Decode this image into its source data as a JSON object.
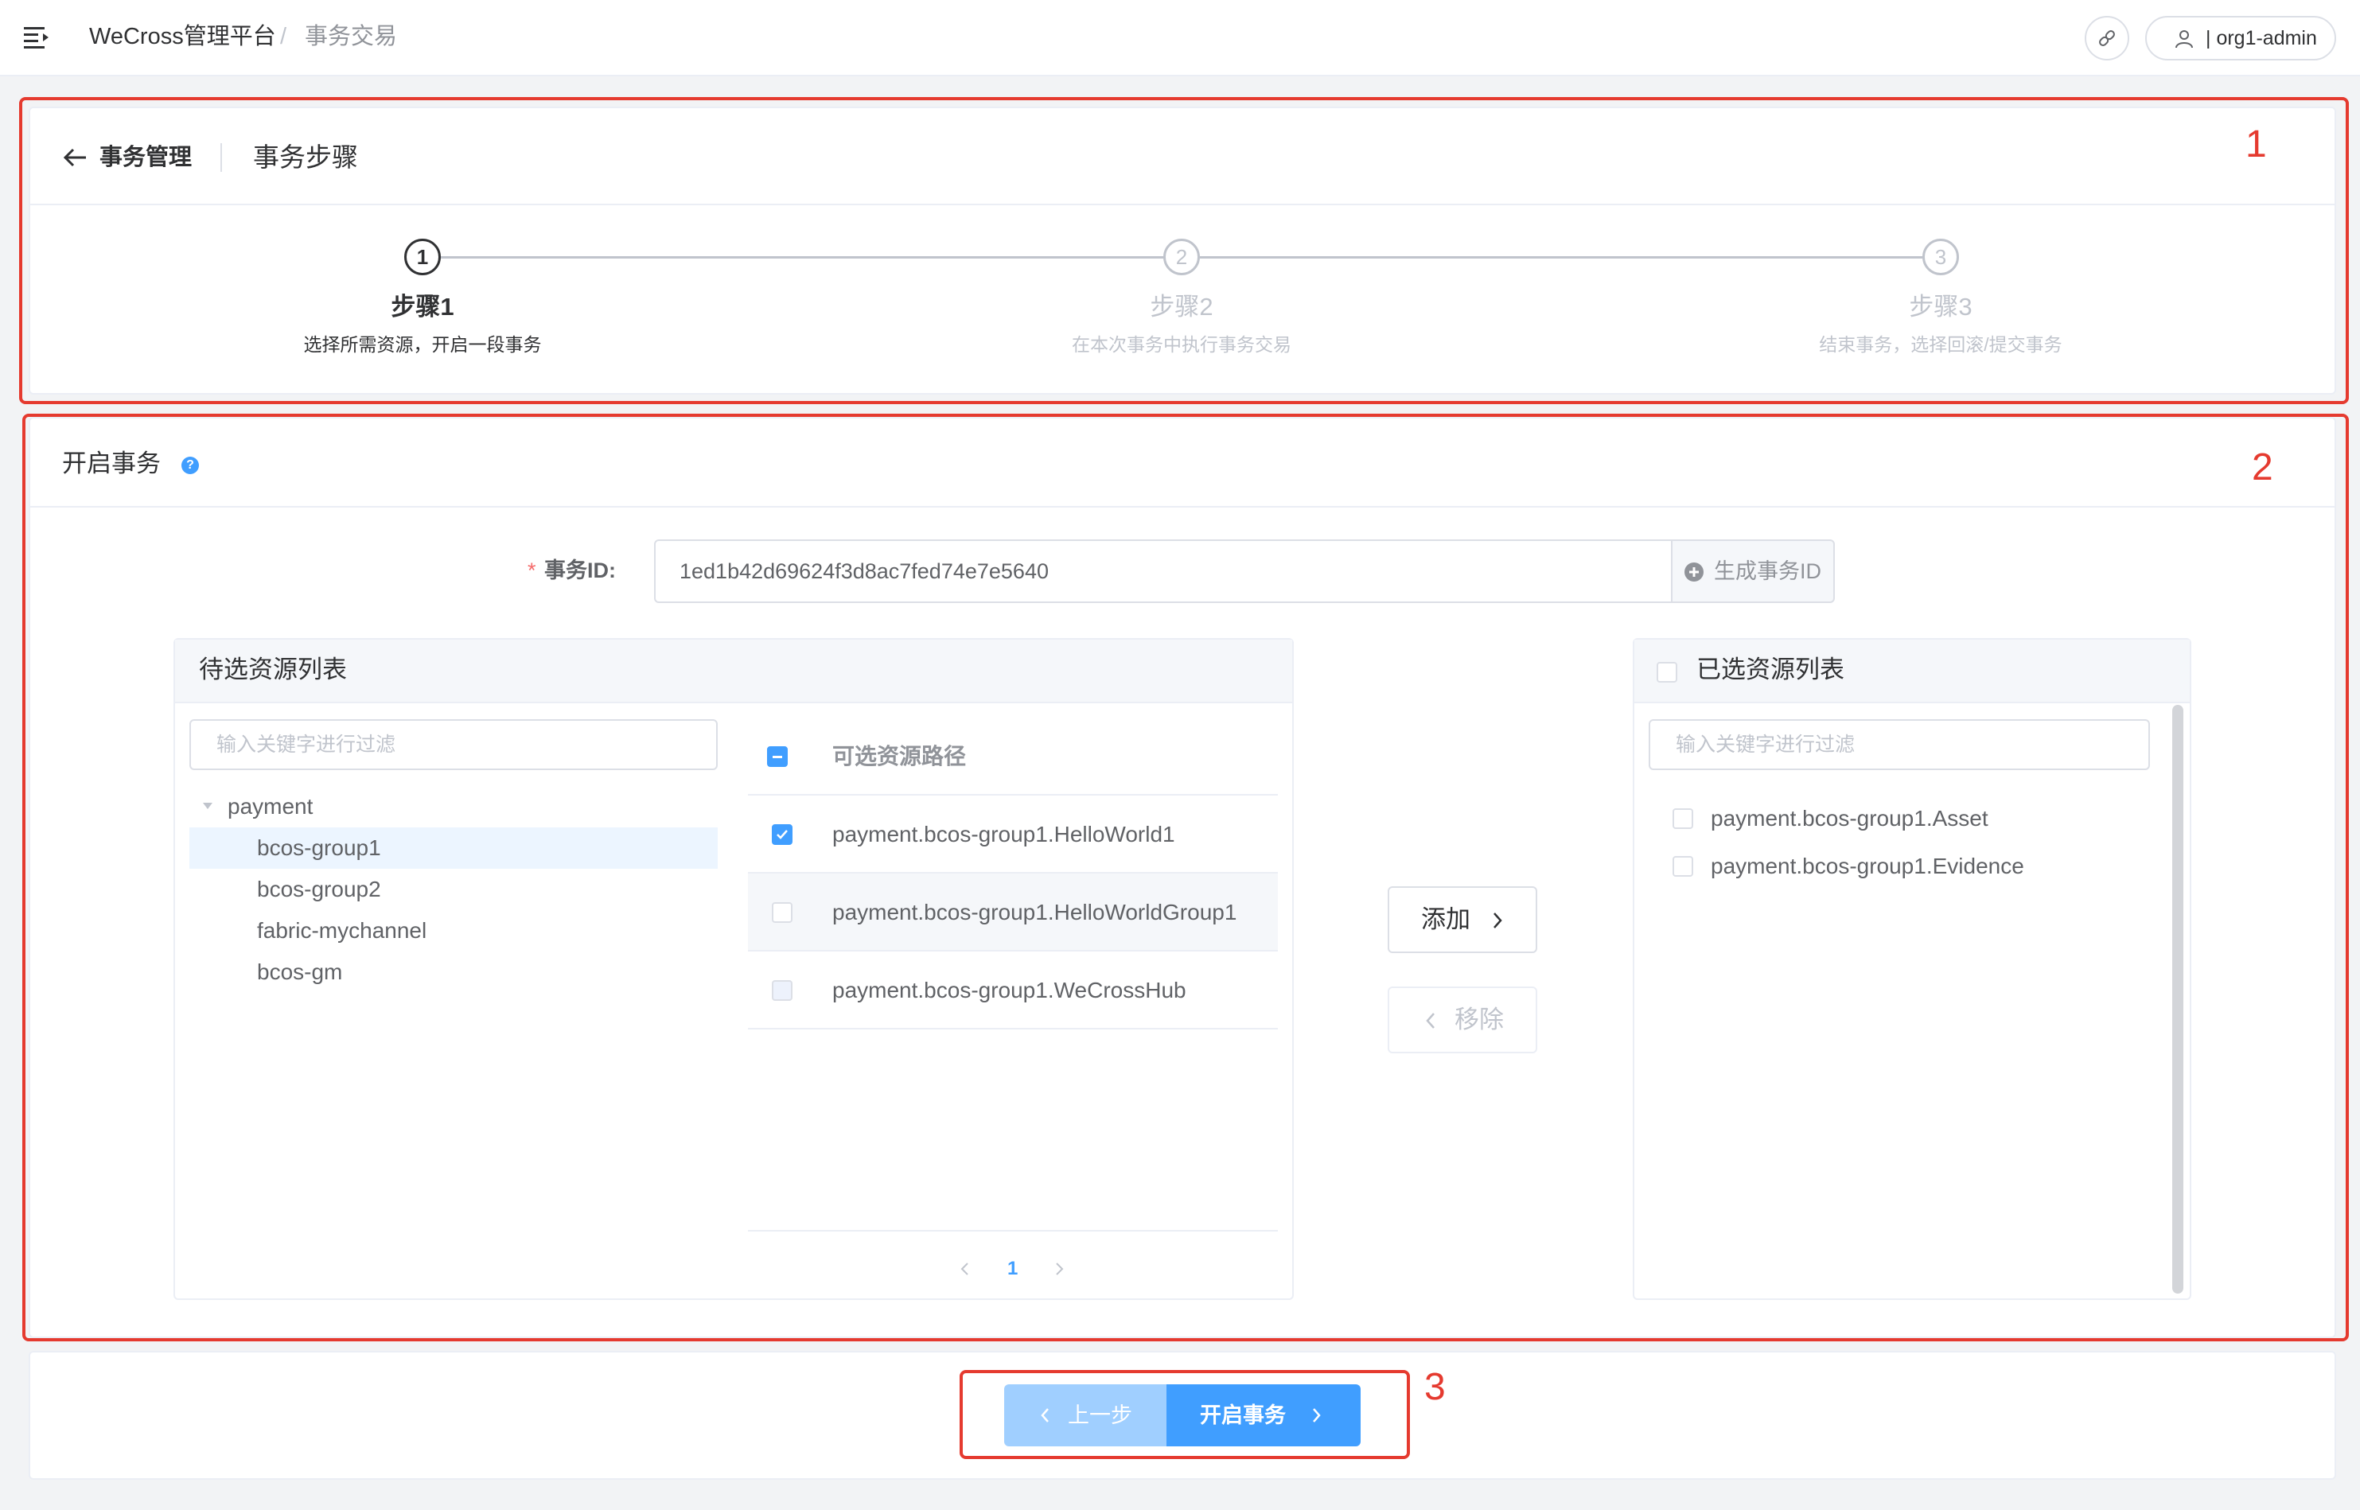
{
  "header": {
    "app_title": "WeCross管理平台",
    "breadcrumb_separator": "/",
    "breadcrumb_page": "事务交易",
    "user_label": "| org1-admin"
  },
  "page_header": {
    "back_label": "事务管理",
    "title": "事务步骤"
  },
  "steps": [
    {
      "number": "1",
      "title": "步骤1",
      "description": "选择所需资源，开启一段事务",
      "status": "active"
    },
    {
      "number": "2",
      "title": "步骤2",
      "description": "在本次事务中执行事务交易",
      "status": "wait"
    },
    {
      "number": "3",
      "title": "步骤3",
      "description": "结束事务，选择回滚/提交事务",
      "status": "wait"
    }
  ],
  "section": {
    "title": "开启事务",
    "help_icon": "?"
  },
  "form": {
    "required_mark": "*",
    "id_label": "事务ID:",
    "id_value": "1ed1b42d69624f3d8ac7fed74e7e5640",
    "generate_button": "生成事务ID"
  },
  "left_panel": {
    "title": "待选资源列表",
    "filter_placeholder": "输入关键字进行过滤",
    "tree": {
      "root": "payment",
      "children": [
        "bcos-group1",
        "bcos-group2",
        "fabric-mychannel",
        "bcos-gm"
      ],
      "selected": "bcos-group1"
    },
    "table_header": "可选资源路径",
    "rows": [
      {
        "path": "payment.bcos-group1.HelloWorld1",
        "state": "checked"
      },
      {
        "path": "payment.bcos-group1.HelloWorldGroup1",
        "state": "unchecked"
      },
      {
        "path": "payment.bcos-group1.WeCrossHub",
        "state": "disabled"
      }
    ],
    "pager": {
      "current": "1"
    }
  },
  "transfer_buttons": {
    "add": "添加",
    "remove": "移除"
  },
  "right_panel": {
    "title": "已选资源列表",
    "filter_placeholder": "输入关键字进行过滤",
    "items": [
      "payment.bcos-group1.Asset",
      "payment.bcos-group1.Evidence"
    ]
  },
  "footer": {
    "prev_button": "上一步",
    "start_button": "开启事务"
  },
  "annotations": [
    "1",
    "2",
    "3"
  ],
  "colors": {
    "primary": "#409eff",
    "primary_light": "#a0cfff",
    "annotation_red": "#e53a2f",
    "text_main": "#303133",
    "text_muted": "#c0c4cc"
  }
}
